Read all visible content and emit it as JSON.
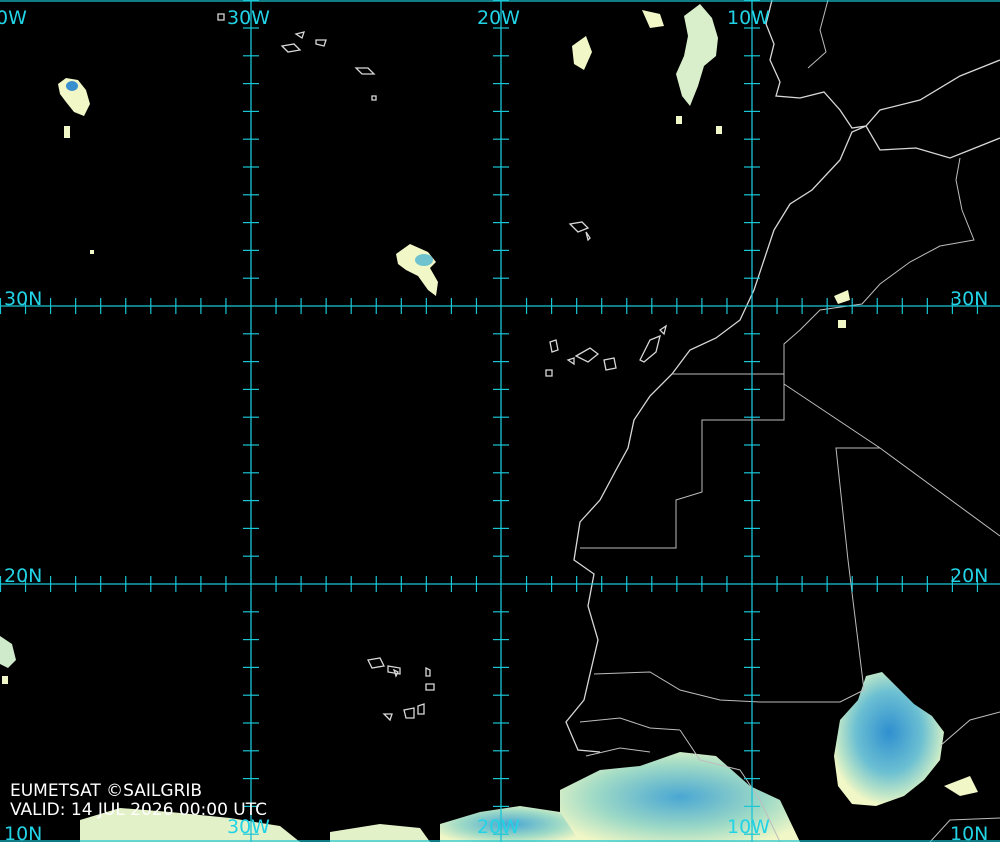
{
  "map": {
    "credit": "EUMETSAT ©SAILGRIB",
    "valid_text": "VALID:  14 JUL 2026 00:00 UTC",
    "colors": {
      "background": "#000000",
      "grid": "#19c6d6",
      "coastline": "#d8d8d8",
      "cloud_light": "#f1f7c6",
      "cloud_mid": "#8fd4c0",
      "cloud_dense": "#2f8fd0"
    },
    "labels": {
      "lon_40w": "0W",
      "lon_30w": "30W",
      "lon_20w": "20W",
      "lon_10w": "10W",
      "lat_30n_left": "30N",
      "lat_30n_right": "30N",
      "lat_20n_left": "20N",
      "lat_20n_right": "20N",
      "bottom_10n_left": "10N",
      "bottom_30w": "30W",
      "bottom_20w": "20W",
      "bottom_10w": "10W",
      "bottom_10n_right": "10N"
    }
  }
}
